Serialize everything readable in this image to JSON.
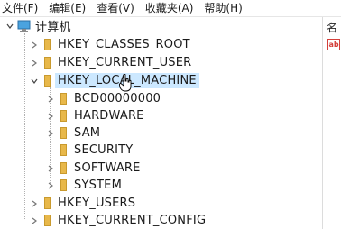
{
  "menubar": {
    "items": [
      {
        "label": "文件(F)"
      },
      {
        "label": "编辑(E)"
      },
      {
        "label": "查看(V)"
      },
      {
        "label": "收藏夹(A)"
      },
      {
        "label": "帮助(H)"
      }
    ]
  },
  "tree": {
    "root": {
      "label": "计算机",
      "icon": "computer-icon",
      "expanded": true
    },
    "hives": [
      {
        "label": "HKEY_CLASSES_ROOT",
        "expanded": false
      },
      {
        "label": "HKEY_CURRENT_USER",
        "expanded": false
      },
      {
        "label": "HKEY_LOCAL_MACHINE",
        "expanded": true,
        "selected": true
      },
      {
        "label": "HKEY_USERS",
        "expanded": false
      },
      {
        "label": "HKEY_CURRENT_CONFIG",
        "expanded": false
      }
    ],
    "local_machine_children": [
      {
        "label": "BCD00000000",
        "has_children": true
      },
      {
        "label": "HARDWARE",
        "has_children": true
      },
      {
        "label": "SAM",
        "has_children": true
      },
      {
        "label": "SECURITY",
        "has_children": false
      },
      {
        "label": "SOFTWARE",
        "has_children": true
      },
      {
        "label": "SYSTEM",
        "has_children": true
      }
    ]
  },
  "details": {
    "column_header": "名",
    "value_icon": "ab"
  },
  "colors": {
    "folder": "#e8b84a",
    "selection": "#cce8ff",
    "value_icon": "#d43f3a"
  }
}
